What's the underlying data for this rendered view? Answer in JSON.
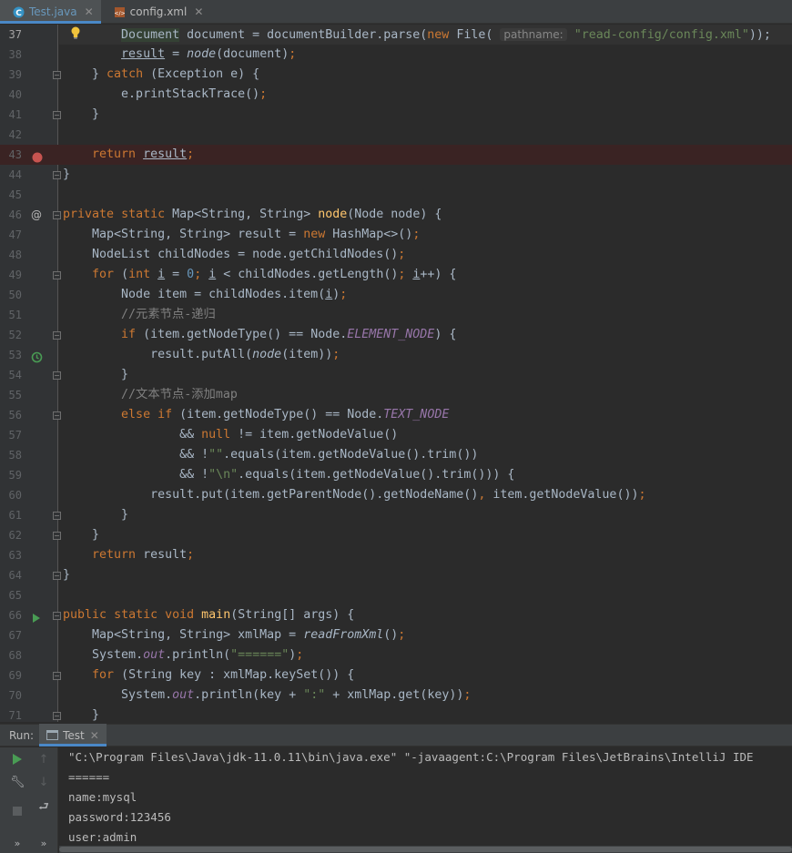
{
  "tabs": [
    {
      "label": "Test.java",
      "icon": "java-class-icon",
      "active": true
    },
    {
      "label": "config.xml",
      "icon": "xml-file-icon",
      "active": false
    }
  ],
  "editor": {
    "lines": [
      {
        "n": "37"
      },
      {
        "n": "38"
      },
      {
        "n": "39"
      },
      {
        "n": "40"
      },
      {
        "n": "41"
      },
      {
        "n": "42"
      },
      {
        "n": "43"
      },
      {
        "n": "44"
      },
      {
        "n": "45"
      },
      {
        "n": "46"
      },
      {
        "n": "47"
      },
      {
        "n": "48"
      },
      {
        "n": "49"
      },
      {
        "n": "50"
      },
      {
        "n": "51"
      },
      {
        "n": "52"
      },
      {
        "n": "53"
      },
      {
        "n": "54"
      },
      {
        "n": "55"
      },
      {
        "n": "56"
      },
      {
        "n": "57"
      },
      {
        "n": "58"
      },
      {
        "n": "59"
      },
      {
        "n": "60"
      },
      {
        "n": "61"
      },
      {
        "n": "62"
      },
      {
        "n": "63"
      },
      {
        "n": "64"
      },
      {
        "n": "65"
      },
      {
        "n": "66"
      },
      {
        "n": "67"
      },
      {
        "n": "68"
      },
      {
        "n": "69"
      },
      {
        "n": "70"
      },
      {
        "n": "71"
      }
    ],
    "t": {
      "l37_a": "Document",
      "l37_b": " document = documentBuilder.parse(",
      "l37_c": "new",
      "l37_d": " File( ",
      "l37_hint": "pathname:",
      "l37_e": " \"read-config/config.xml\"",
      "l37_f": "));",
      "l38_a": "result",
      "l38_b": " = ",
      "l38_c": "node",
      "l38_d": "(document)",
      "l38_e": ";",
      "l39_a": "} ",
      "l39_b": "catch",
      "l39_c": " (Exception e) {",
      "l40_a": "e.printStackTrace()",
      "l40_b": ";",
      "l41": "}",
      "l43_a": "return",
      "l43_b": " ",
      "l43_c": "result",
      "l43_d": ";",
      "l44": "}",
      "l46_a": "private",
      "l46_b": " ",
      "l46_c": "static",
      "l46_d": " Map<String, String> ",
      "l46_e": "node",
      "l46_f": "(Node node) {",
      "l47_a": "Map<String, String> result = ",
      "l47_b": "new",
      "l47_c": " HashMap<>()",
      "l47_d": ";",
      "l48_a": "NodeList childNodes = node.getChildNodes()",
      "l48_b": ";",
      "l49_a": "for",
      "l49_b": " (",
      "l49_c": "int",
      "l49_d": " ",
      "l49_e": "i",
      "l49_f": " = ",
      "l49_g": "0",
      "l49_h": "; ",
      "l49_i": "i",
      "l49_j": " < childNodes.getLength()",
      "l49_k": "; ",
      "l49_l": "i",
      "l49_m": "++) {",
      "l50_a": "Node item = childNodes.item(",
      "l50_b": "i",
      "l50_c": ")",
      "l50_d": ";",
      "l51": "//元素节点-递归",
      "l52_a": "if",
      "l52_b": " (item.getNodeType() == Node.",
      "l52_c": "ELEMENT_NODE",
      "l52_d": ") {",
      "l53_a": "result.putAll(",
      "l53_b": "node",
      "l53_c": "(item))",
      "l53_d": ";",
      "l54": "}",
      "l55": "//文本节点-添加map",
      "l56_a": "else",
      "l56_b": " ",
      "l56_c": "if",
      "l56_d": " (item.getNodeType() == Node.",
      "l56_e": "TEXT_NODE",
      "l57_a": "&& ",
      "l57_b": "null",
      "l57_c": " != item.getNodeValue()",
      "l58_a": "&& !",
      "l58_b": "\"\"",
      "l58_c": ".equals(item.getNodeValue().trim())",
      "l59_a": "&& !",
      "l59_b": "\"\\n\"",
      "l59_c": ".equals(item.getNodeValue().trim())) {",
      "l60_a": "result.put(item.getParentNode().getNodeName()",
      "l60_b": ",",
      "l60_c": " item.getNodeValue())",
      "l60_d": ";",
      "l61": "}",
      "l62": "}",
      "l63_a": "return",
      "l63_b": " result",
      "l63_c": ";",
      "l64": "}",
      "l66_a": "public",
      "l66_b": " ",
      "l66_c": "static",
      "l66_d": " ",
      "l66_e": "void",
      "l66_f": " ",
      "l66_g": "main",
      "l66_h": "(String[] args) {",
      "l67_a": "Map<String, String> xmlMap = ",
      "l67_b": "readFromXml",
      "l67_c": "()",
      "l67_d": ";",
      "l68_a": "System.",
      "l68_b": "out",
      "l68_c": ".println(",
      "l68_d": "\"======\"",
      "l68_e": ")",
      "l68_f": ";",
      "l69_a": "for",
      "l69_b": " (String key : xmlMap.keySet()) {",
      "l70_a": "System.",
      "l70_b": "out",
      "l70_c": ".println(key + ",
      "l70_d": "\":\"",
      "l70_e": " + xmlMap.get(key))",
      "l70_f": ";",
      "l71": "}"
    }
  },
  "run": {
    "label": "Run:",
    "tab_label": "Test",
    "console": [
      "\"C:\\Program Files\\Java\\jdk-11.0.11\\bin\\java.exe\" \"-javaagent:C:\\Program Files\\JetBrains\\IntelliJ IDE",
      "======",
      "name:mysql",
      "password:123456",
      "user:admin"
    ]
  },
  "colors": {
    "keyword": "#cc7832",
    "string": "#6a8759",
    "number": "#6897bb",
    "comment": "#808080",
    "method_decl": "#ffc66d",
    "static_field": "#9876aa",
    "breakpoint": "#c75450"
  }
}
